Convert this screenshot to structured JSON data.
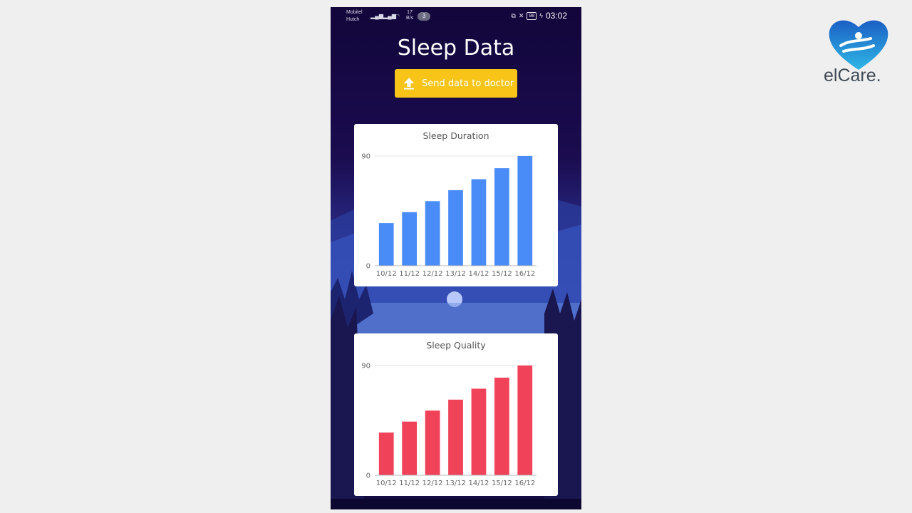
{
  "status_bar": {
    "carrier_1": "Mobitel",
    "carrier_2": "Hutch",
    "net_speed_value": "17",
    "net_speed_unit": "B/s",
    "notification_count": "3",
    "battery": "98",
    "time": "03:02"
  },
  "page": {
    "title": "Sleep Data",
    "send_button_label": "Send data to doctor"
  },
  "brand": {
    "name": "elCare."
  },
  "colors": {
    "button": "#f7c417",
    "duration_bars": "#4a8cf7",
    "quality_bars": "#f04258"
  },
  "chart_data": [
    {
      "type": "bar",
      "title": "Sleep Duration",
      "categories": [
        "10/12",
        "11/12",
        "12/12",
        "13/12",
        "14/12",
        "15/12",
        "16/12"
      ],
      "values": [
        35,
        44,
        53,
        62,
        71,
        80,
        90
      ],
      "ylim": [
        0,
        90
      ],
      "yticks": [
        "0",
        "90"
      ],
      "color": "#4a8cf7"
    },
    {
      "type": "bar",
      "title": "Sleep Quality",
      "categories": [
        "10/12",
        "11/12",
        "12/12",
        "13/12",
        "14/12",
        "15/12",
        "16/12"
      ],
      "values": [
        35,
        44,
        53,
        62,
        71,
        80,
        90
      ],
      "ylim": [
        0,
        90
      ],
      "yticks": [
        "0",
        "90"
      ],
      "color": "#f04258"
    }
  ]
}
